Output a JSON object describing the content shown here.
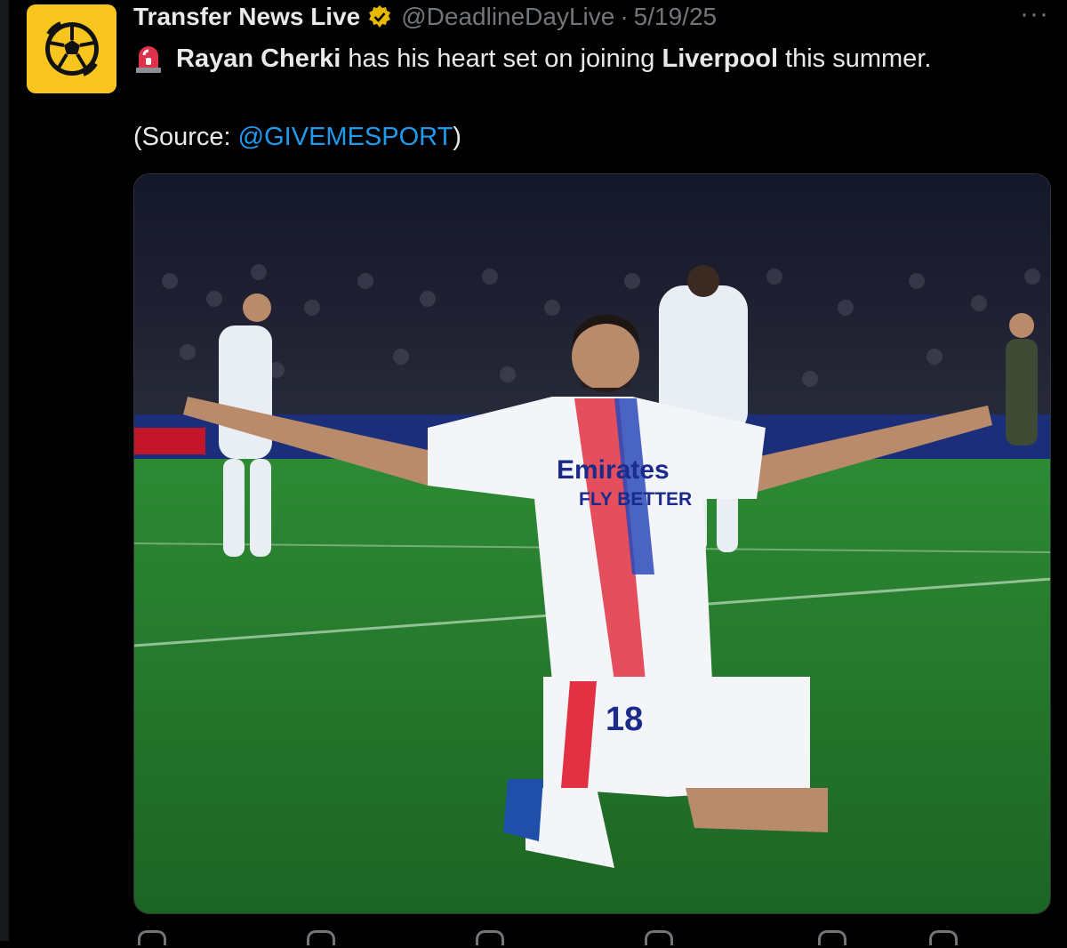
{
  "tweet": {
    "display_name": "Transfer News Live",
    "handle": "@DeadlineDayLive",
    "separator": "·",
    "date": "5/19/25",
    "line1": {
      "name_bold": "Rayan Cherki",
      "text_mid": " has his heart set on joining ",
      "club_bold": "Liverpool",
      "text_end": " this summer."
    },
    "source": {
      "prefix": "(Source: ",
      "mention": "@GIVEMESPORT",
      "suffix": ")"
    },
    "media": {
      "shirt_sponsor": "Emirates",
      "shirt_slogan": "FLY BETTER",
      "shirt_number": "18"
    }
  },
  "icons": {
    "avatar": "football-logo-icon",
    "verified": "verified-badge-icon",
    "more": "more-options-icon",
    "siren": "siren-emoji-icon"
  },
  "colors": {
    "background": "#000000",
    "text": "#e7e9ea",
    "secondary": "#71767b",
    "link": "#1d9bf0",
    "avatar_bg": "#f7c51e",
    "verified": "#e6b800"
  }
}
